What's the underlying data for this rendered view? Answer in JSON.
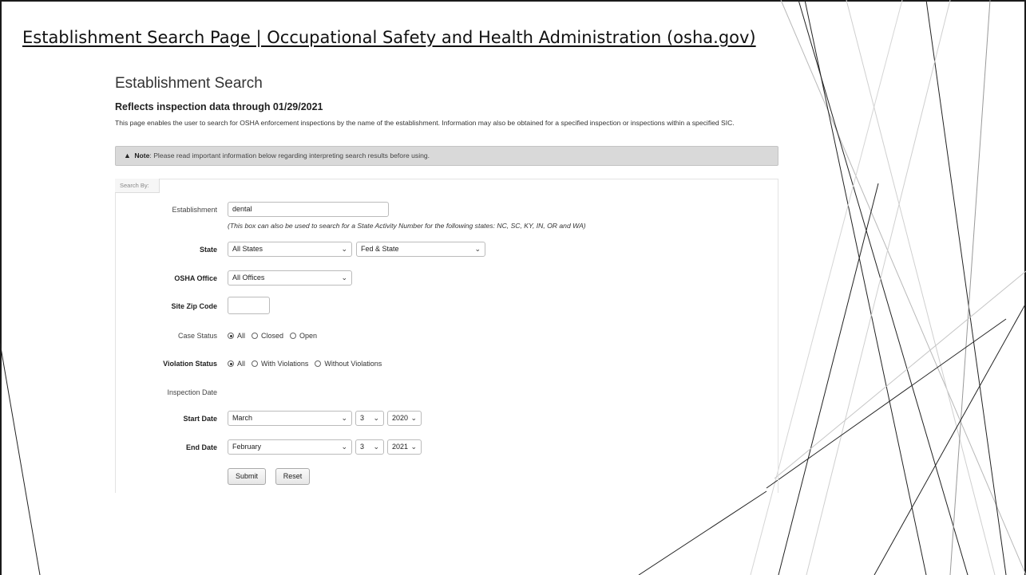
{
  "slide": {
    "title": "Establishment Search Page | Occupational Safety and Health Administration (osha.gov)"
  },
  "page": {
    "heading": "Establishment Search",
    "subheading": "Reflects inspection data through 01/29/2021",
    "intro": "This page enables the user to search for OSHA enforcement inspections by the name of the establishment. Information may also be obtained for a specified inspection or inspections within a specified SIC.",
    "note_label": "Note",
    "note_text": ": Please read important information below regarding interpreting search results before using.",
    "note_icon": "warning-icon"
  },
  "form": {
    "tab_label": "Search By:",
    "establishment": {
      "label": "Establishment",
      "value": "dental",
      "hint": "(This box can also be used to search for a State Activity Number for the following states: NC, SC, KY, IN, OR and WA)"
    },
    "state": {
      "label": "State",
      "value": "All States",
      "scope": "Fed & State"
    },
    "office": {
      "label": "OSHA Office",
      "value": "All Offices"
    },
    "zip": {
      "label": "Site Zip Code",
      "value": ""
    },
    "case_status": {
      "label": "Case Status",
      "options": [
        "All",
        "Closed",
        "Open"
      ],
      "selected": "All"
    },
    "violation_status": {
      "label": "Violation Status",
      "options": [
        "All",
        "With Violations",
        "Without Violations"
      ],
      "selected": "All"
    },
    "inspection_date_label": "Inspection Date",
    "start_date": {
      "label": "Start Date",
      "month": "March",
      "day": "3",
      "year": "2020"
    },
    "end_date": {
      "label": "End Date",
      "month": "February",
      "day": "3",
      "year": "2021"
    },
    "submit_label": "Submit",
    "reset_label": "Reset"
  },
  "colors": {
    "frame": "#1a1a1a",
    "note_bg": "#d9d9d9",
    "text": "#333333"
  }
}
